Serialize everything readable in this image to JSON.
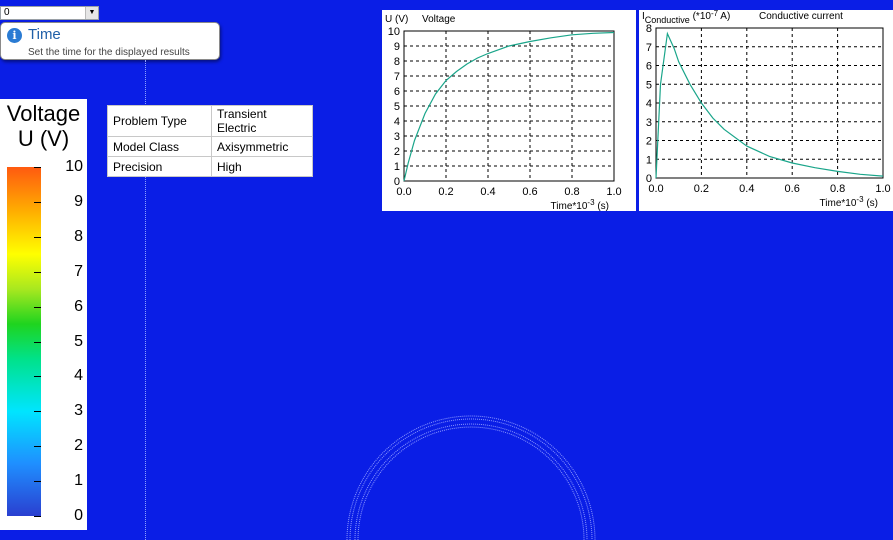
{
  "time_selector": {
    "value": "0"
  },
  "tooltip": {
    "title": "Time",
    "description": "Set the time for the displayed results"
  },
  "legend": {
    "title_line1": "Voltage",
    "title_line2": "U (V)",
    "labels": [
      "10",
      "9",
      "8",
      "7",
      "6",
      "5",
      "4",
      "3",
      "2",
      "1",
      "0"
    ]
  },
  "properties": [
    {
      "key": "Problem Type",
      "value": "Transient Electric"
    },
    {
      "key": "Model Class",
      "value": "Axisymmetric"
    },
    {
      "key": "Precision",
      "value": "High"
    }
  ],
  "colors": {
    "background": "#0a1ee6",
    "curve": "#1aa58a"
  },
  "chart_data": [
    {
      "type": "line",
      "title": "Voltage",
      "ylabel": "U (V)",
      "xlabel": "Time*10-3 (s)",
      "xlabel_main": "Time*10",
      "xlabel_exp": "-3",
      "xlabel_unit": "(s)",
      "xlim": [
        0,
        1.0
      ],
      "ylim": [
        0,
        10
      ],
      "xticks": [
        "0.0",
        "0.2",
        "0.4",
        "0.6",
        "0.8",
        "1.0"
      ],
      "yticks": [
        "0",
        "1",
        "2",
        "3",
        "4",
        "5",
        "6",
        "7",
        "8",
        "9",
        "10"
      ],
      "grid": true,
      "series": [
        {
          "x": [
            0,
            0.02,
            0.05,
            0.1,
            0.15,
            0.2,
            0.25,
            0.3,
            0.35,
            0.4,
            0.5,
            0.6,
            0.7,
            0.8,
            0.9,
            1.0
          ],
          "values": [
            0,
            1.2,
            2.7,
            4.5,
            5.8,
            6.7,
            7.3,
            7.8,
            8.2,
            8.5,
            9.0,
            9.3,
            9.55,
            9.75,
            9.85,
            9.9
          ]
        }
      ]
    },
    {
      "type": "line",
      "title": "Conductive current",
      "ylabel": "IConductive (*10-7 A)",
      "ylabel_I": "I",
      "ylabel_sub": "Conductive",
      "ylabel_unit_pre": "(*10",
      "ylabel_exp": "-7",
      "ylabel_unit_post": " A)",
      "xlabel": "Time*10-3 (s)",
      "xlabel_main": "Time*10",
      "xlabel_exp": "-3",
      "xlabel_unit": "(s)",
      "xlim": [
        0,
        1.0
      ],
      "ylim": [
        0,
        8
      ],
      "xticks": [
        "0.0",
        "0.2",
        "0.4",
        "0.6",
        "0.8",
        "1.0"
      ],
      "yticks": [
        "0",
        "1",
        "2",
        "3",
        "4",
        "5",
        "6",
        "7",
        "8"
      ],
      "grid": true,
      "series": [
        {
          "x": [
            0,
            0.02,
            0.05,
            0.08,
            0.1,
            0.15,
            0.2,
            0.25,
            0.3,
            0.4,
            0.5,
            0.6,
            0.7,
            0.8,
            0.9,
            1.0
          ],
          "values": [
            0,
            5.0,
            7.7,
            6.9,
            6.2,
            5.0,
            4.0,
            3.2,
            2.6,
            1.7,
            1.15,
            0.8,
            0.55,
            0.35,
            0.2,
            0.1
          ]
        }
      ]
    }
  ]
}
